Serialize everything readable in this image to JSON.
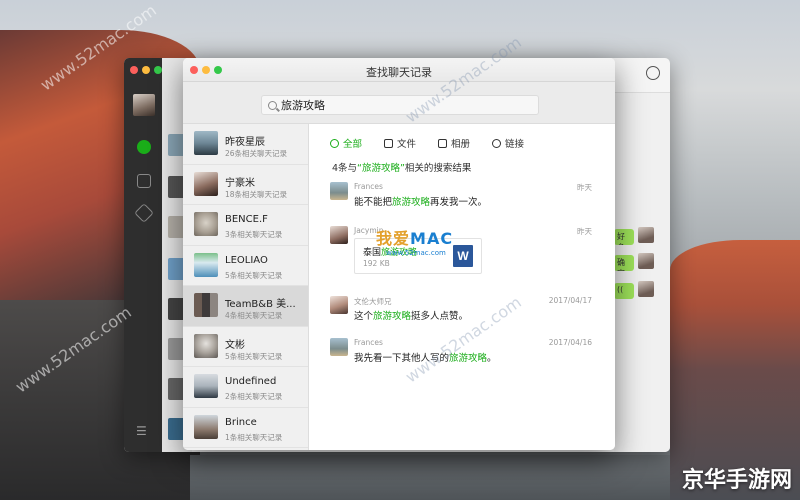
{
  "window": {
    "title": "查找聊天记录"
  },
  "search": {
    "query": "旅游攻略"
  },
  "contacts": [
    {
      "name": "昨夜星辰",
      "count": "26条相关聊天记录"
    },
    {
      "name": "宁豪米",
      "count": "18条相关聊天记录"
    },
    {
      "name": "BENCE.F",
      "count": "3条相关聊天记录"
    },
    {
      "name": "LEOLIAO",
      "count": "5条相关聊天记录"
    },
    {
      "name": "TeamB&B 美...",
      "count": "4条相关聊天记录"
    },
    {
      "name": "文彬",
      "count": "5条相关聊天记录"
    },
    {
      "name": "Undefined",
      "count": "2条相关聊天记录"
    },
    {
      "name": "Brince",
      "count": "1条相关聊天记录"
    }
  ],
  "filters": [
    {
      "label": "全部",
      "icon": "chat-icon"
    },
    {
      "label": "文件",
      "icon": "file-icon"
    },
    {
      "label": "相册",
      "icon": "image-icon"
    },
    {
      "label": "链接",
      "icon": "link-icon"
    }
  ],
  "results": {
    "prefix": "4条与",
    "keyword": "“旅游攻略”",
    "suffix": "相关的搜索结果"
  },
  "messages": [
    {
      "sender": "Frances",
      "date": "昨天",
      "text_before": "能不能把",
      "keyword": "旅游攻略",
      "text_after": "再发我一次。"
    },
    {
      "sender": "Jacymin",
      "date": "昨天",
      "file_before": "泰国",
      "file_keyword": "旅游攻略",
      "file_size": "192 KB",
      "file_icon_letter": "W"
    },
    {
      "sender": "文伦大师兄",
      "date": "2017/04/17",
      "text_before": "这个",
      "keyword": "旅游攻略",
      "text_after": "挺多人点赞。"
    },
    {
      "sender": "Frances",
      "date": "2017/04/16",
      "text_before": "我先看一下其他人写的",
      "keyword": "旅游攻略",
      "text_after": "。"
    }
  ],
  "back_window": {
    "bubbles": [
      "好多",
      "确定",
      "(("
    ]
  },
  "watermarks": {
    "site": "www.52mac.com",
    "logo_main": "我爱",
    "logo_main2": "MAC",
    "logo_sub": "www.52mac.com",
    "brand": "京华手游网"
  },
  "colors": {
    "accent": "#1aad19",
    "word": "#2b579a"
  }
}
